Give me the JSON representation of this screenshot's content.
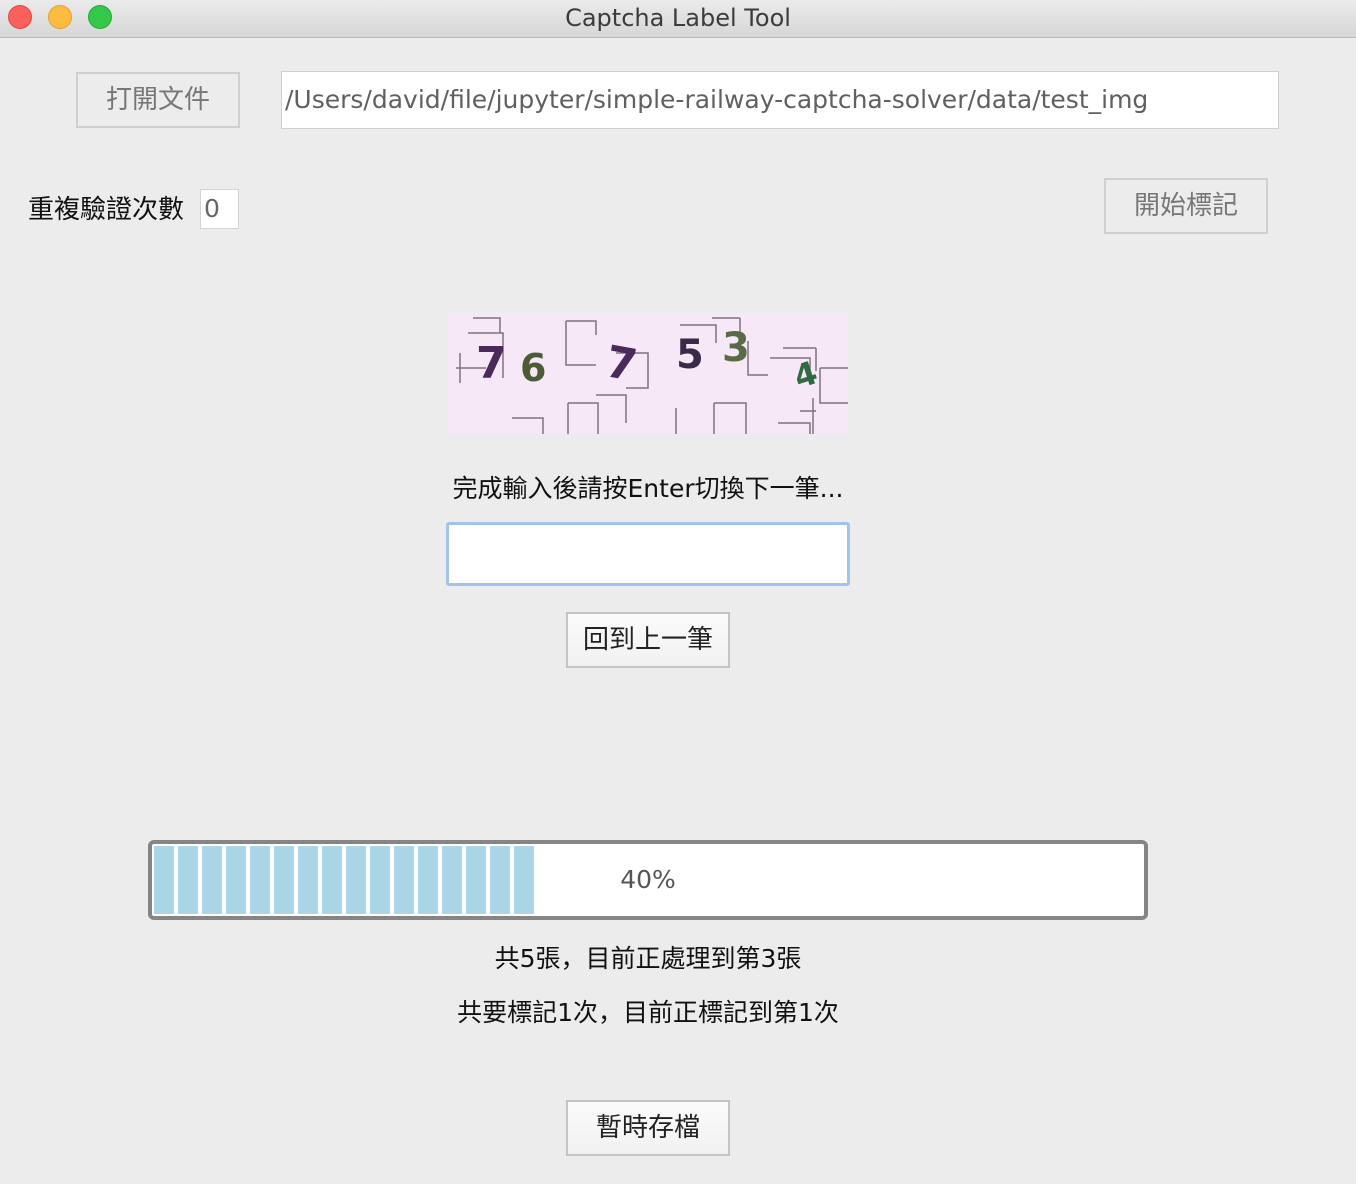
{
  "window": {
    "title": "Captcha Label Tool"
  },
  "file": {
    "open_label": "打開文件",
    "path": "/Users/david/file/jupyter/simple-railway-captcha-solver/data/test_img"
  },
  "repeat": {
    "label": "重複驗證次數",
    "value": "0"
  },
  "start_label": "開始標記",
  "captcha": {
    "characters": [
      "7",
      "6",
      "7",
      "5",
      "3",
      "4"
    ]
  },
  "hint": "完成輸入後請按Enter切換下一筆...",
  "input": {
    "value": ""
  },
  "prev_label": "回到上一筆",
  "progress": {
    "fraction": 0.4,
    "text": "40%"
  },
  "status": {
    "images": "共5張，目前正處理到第3張",
    "rounds": "共要標記1次，目前正標記到第1次"
  },
  "save_label": "暫時存檔"
}
